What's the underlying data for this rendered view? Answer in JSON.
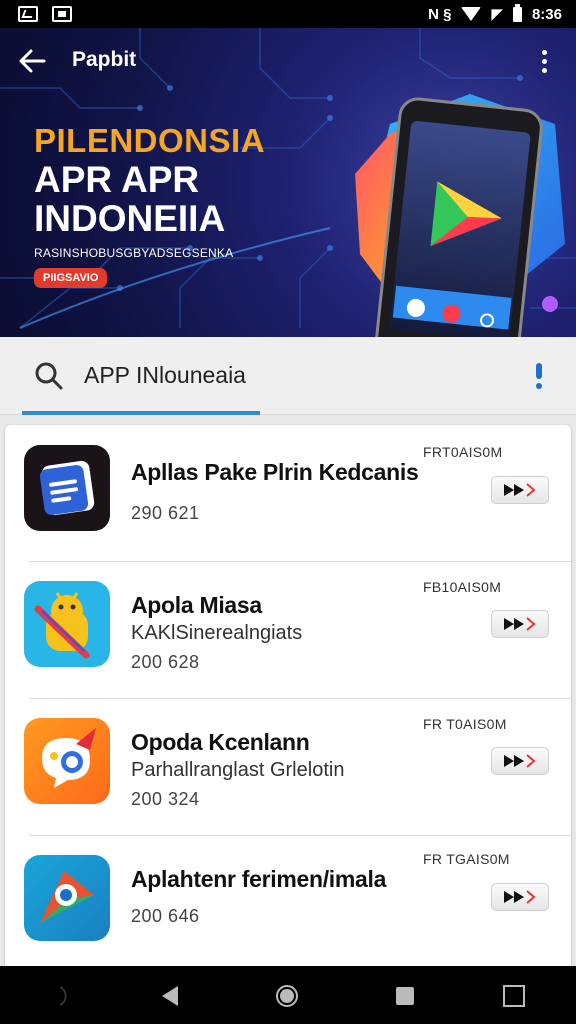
{
  "status_bar": {
    "time": "8:36",
    "right_glyphs": "N §",
    "left_icons": [
      "notification-icon",
      "notification-icon"
    ]
  },
  "header": {
    "title": "Papbit"
  },
  "hero": {
    "line1": "PILENDONSIA",
    "line2": "APR APR",
    "line3": "INDONEIIA",
    "small_text": "RASINSHOBUSGBYADSEGSENKA",
    "badge": "PIIGSAVIO"
  },
  "search": {
    "value": "APP INlouneaia",
    "accent_color": "#2f8cd6"
  },
  "apps": [
    {
      "name": "Apllas Pake Plrin Kedcanis",
      "subtitle": "",
      "meta": "290 621",
      "tag": "FRT0AIS0M",
      "icon": "document-app-icon"
    },
    {
      "name": "Apola Miasa",
      "subtitle": "KAKlSinerealngiats",
      "meta": "200 628",
      "tag": "FB10AIS0M",
      "icon": "android-app-icon"
    },
    {
      "name": "Opoda Kcenlann",
      "subtitle": "Parhallranglast Grlelotin",
      "meta": "200 324",
      "tag": "FR T0AIS0M",
      "icon": "chat-app-icon"
    },
    {
      "name": "Aplahtenr ferimen/imala",
      "subtitle": "",
      "meta": "200 646",
      "tag": "FR TGAIS0M",
      "icon": "compass-app-icon"
    }
  ]
}
